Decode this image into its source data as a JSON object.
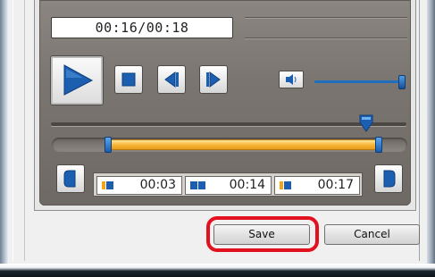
{
  "player": {
    "time_display": "00:16/00:18",
    "current_time": "00:16",
    "duration": "00:18",
    "volume_fraction": 0.98,
    "seek_fraction": 0.89,
    "range_start_fraction": 0.167,
    "range_end_fraction": 0.944
  },
  "markers": [
    {
      "time": "00:03",
      "icon": "start-marker-icon"
    },
    {
      "time": "00:14",
      "icon": "in-out-marker-icon"
    },
    {
      "time": "00:17",
      "icon": "start-marker-icon"
    }
  ],
  "buttons": {
    "save_label": "Save",
    "cancel_label": "Cancel"
  },
  "colors": {
    "accent_blue": "#1e6fc0",
    "range_orange": "#f7b63a",
    "highlight_red": "#e3101f",
    "player_bg": "#7a7570"
  },
  "icons": {
    "play": "play-icon",
    "stop": "stop-icon",
    "prev_frame": "previous-frame-icon",
    "next_frame": "next-frame-icon",
    "volume": "speaker-icon",
    "set_start": "set-start-icon",
    "set_end": "set-end-icon"
  }
}
